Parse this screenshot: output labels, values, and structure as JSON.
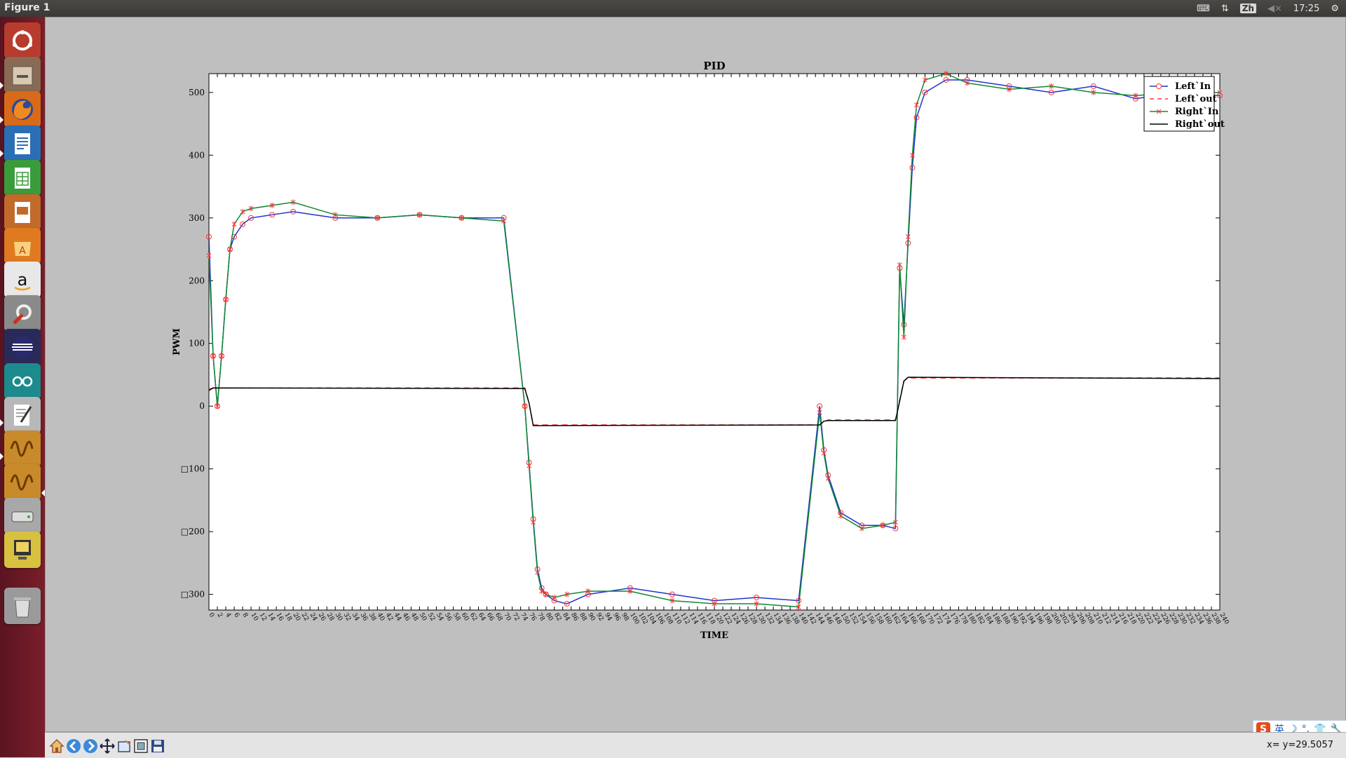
{
  "window": {
    "title": "Figure 1"
  },
  "tray": {
    "input_method": "Zh",
    "time": "17:25"
  },
  "launcher": {
    "items": [
      {
        "name": "ubuntu-dash-icon",
        "bg": "#b83c2e"
      },
      {
        "name": "files-icon",
        "bg": "#8a6a52"
      },
      {
        "name": "firefox-icon",
        "bg": "#d86a1a"
      },
      {
        "name": "writer-icon",
        "bg": "#2a6fb5"
      },
      {
        "name": "calc-icon",
        "bg": "#3a9b3a"
      },
      {
        "name": "impress-icon",
        "bg": "#c26a2a"
      },
      {
        "name": "software-center-icon",
        "bg": "#e07a20"
      },
      {
        "name": "amazon-icon",
        "bg": "#e8e8e8"
      },
      {
        "name": "system-settings-icon",
        "bg": "#8a8a8a"
      },
      {
        "name": "eclipse-icon",
        "bg": "#2a2a5a"
      },
      {
        "name": "arduino-icon",
        "bg": "#1d8a8e"
      },
      {
        "name": "text-editor-icon",
        "bg": "#b8b8b8"
      },
      {
        "name": "oscilloscope-icon",
        "bg": "#c88a2a"
      },
      {
        "name": "oscilloscope-icon-2",
        "bg": "#c88a2a"
      },
      {
        "name": "drive-icon",
        "bg": "#a8a8a8"
      },
      {
        "name": "network-app-icon",
        "bg": "#d8c040"
      },
      {
        "name": "trash-icon",
        "bg": "#9a9a9a"
      }
    ]
  },
  "chart_data": {
    "type": "line",
    "title": "PID",
    "xlabel": "TIME",
    "ylabel": "PWM",
    "ylim": [
      -325,
      530
    ],
    "xlim": [
      0,
      240
    ],
    "yticks": [
      "500",
      "400",
      "300",
      "200",
      "100",
      "0",
      "□100",
      "□200",
      "□300"
    ],
    "ytick_values": [
      500,
      400,
      300,
      200,
      100,
      0,
      -100,
      -200,
      -300
    ],
    "legend_position": "top-right",
    "grid": false,
    "series": [
      {
        "name": "Left`In",
        "style": "circle",
        "color": "#2233cc",
        "marker_color": "#ff3333",
        "x": [
          0,
          1,
          2,
          3,
          4,
          5,
          6,
          8,
          10,
          15,
          20,
          30,
          40,
          50,
          60,
          70,
          75,
          76,
          77,
          78,
          79,
          80,
          82,
          85,
          90,
          100,
          110,
          120,
          130,
          140,
          145,
          146,
          147,
          150,
          155,
          160,
          163,
          164,
          165,
          166,
          167,
          168,
          170,
          175,
          180,
          190,
          200,
          210,
          220,
          230,
          240
        ],
        "y": [
          270,
          80,
          0,
          80,
          170,
          250,
          270,
          290,
          300,
          305,
          310,
          300,
          300,
          305,
          300,
          300,
          0,
          -90,
          -180,
          -260,
          -290,
          -300,
          -310,
          -315,
          -300,
          -290,
          -300,
          -310,
          -305,
          -310,
          0,
          -70,
          -110,
          -170,
          -190,
          -190,
          -195,
          220,
          130,
          260,
          380,
          460,
          500,
          520,
          520,
          510,
          500,
          510,
          490,
          500,
          495
        ]
      },
      {
        "name": "Left`out",
        "style": "dash",
        "color": "#ff3333",
        "x": [
          0,
          1,
          75,
          76,
          77,
          145,
          146,
          147,
          163,
          164,
          165,
          166,
          240
        ],
        "y": [
          27,
          29,
          29,
          5,
          -30,
          -30,
          -25,
          -22,
          -22,
          10,
          40,
          45,
          45
        ]
      },
      {
        "name": "Right`In",
        "style": "star",
        "color": "#118833",
        "marker_color": "#ff3333",
        "x": [
          0,
          1,
          2,
          3,
          4,
          5,
          6,
          8,
          10,
          15,
          20,
          30,
          40,
          50,
          60,
          70,
          75,
          76,
          77,
          78,
          79,
          80,
          82,
          85,
          90,
          100,
          110,
          120,
          130,
          140,
          145,
          146,
          147,
          150,
          155,
          160,
          163,
          164,
          165,
          166,
          167,
          168,
          170,
          175,
          180,
          190,
          200,
          210,
          220,
          230,
          240
        ],
        "y": [
          240,
          80,
          0,
          80,
          170,
          250,
          290,
          310,
          315,
          320,
          325,
          305,
          300,
          305,
          300,
          295,
          0,
          -95,
          -185,
          -265,
          -295,
          -300,
          -305,
          -300,
          -295,
          -295,
          -310,
          -315,
          -315,
          -320,
          -10,
          -75,
          -115,
          -175,
          -195,
          -190,
          -185,
          225,
          110,
          270,
          400,
          480,
          520,
          530,
          515,
          505,
          510,
          500,
          495,
          500,
          500
        ]
      },
      {
        "name": "Right`out",
        "style": "solid",
        "color": "#000000",
        "x": [
          0,
          1,
          75,
          76,
          77,
          145,
          146,
          147,
          163,
          164,
          165,
          166,
          240
        ],
        "y": [
          25,
          29,
          28,
          5,
          -31,
          -30,
          -24,
          -23,
          -23,
          8,
          40,
          46,
          44
        ]
      }
    ]
  },
  "toolbar": {
    "coord_readout": "x= y=29.5057"
  },
  "ime": {
    "logo": "S",
    "label": "英"
  }
}
